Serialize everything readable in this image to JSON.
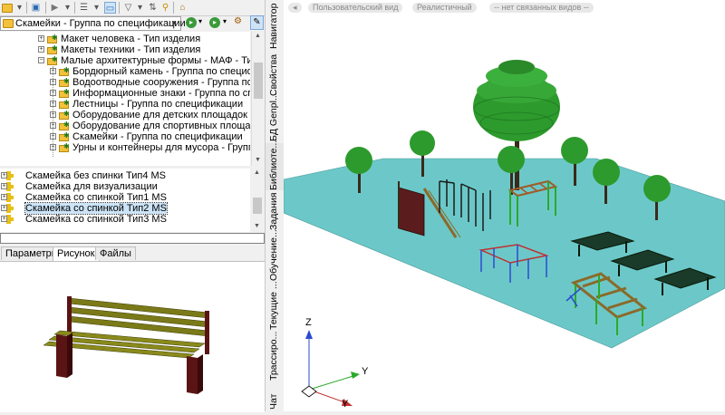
{
  "toolbar": {
    "icons": [
      "folder-icon",
      "dropdown-arrow",
      "save-icon",
      "play-icon",
      "dropdown-arrow",
      "tree-view-icon",
      "dropdown-arrow",
      "panel-icon",
      "filter-icon",
      "dropdown-arrow",
      "sort-icon",
      "search-icon",
      "pin-icon"
    ]
  },
  "combo": {
    "value": "Скамейки - Группа по спецификации"
  },
  "tree": {
    "items": [
      {
        "label": "Макет человека - Тип изделия",
        "level": 0,
        "expander": "+"
      },
      {
        "label": "Макеты техники - Тип изделия",
        "level": 0,
        "expander": "+"
      },
      {
        "label": "Малые архитектурные формы - МАФ - Тип изделия",
        "level": 0,
        "expander": "−"
      },
      {
        "label": "Бордюрный камень - Группа по спецификации",
        "level": 1,
        "expander": "+"
      },
      {
        "label": "Водоотводные сооружения - Группа по спецификации",
        "level": 1,
        "expander": "+"
      },
      {
        "label": "Информационные знаки - Группа по спецификации",
        "level": 1,
        "expander": "+"
      },
      {
        "label": "Лестницы - Группа по спецификации",
        "level": 1,
        "expander": "+"
      },
      {
        "label": "Оборудование для детских площадок - Группа по спецификации",
        "level": 1,
        "expander": "+"
      },
      {
        "label": "Оборудование для спортивных площадок - Группа по спецификации",
        "level": 1,
        "expander": "+"
      },
      {
        "label": "Скамейки - Группа по спецификации",
        "level": 1,
        "expander": "+"
      },
      {
        "label": "Урны и контейнеры для мусора - Группа по спецификации",
        "level": 1,
        "expander": "+"
      }
    ]
  },
  "list": {
    "items": [
      {
        "label": "Скамейка без спинки Тип4 MS",
        "selected": false
      },
      {
        "label": "Скамейка для визуализации",
        "selected": false
      },
      {
        "label": "Скамейка со спинкой Тип1 MS",
        "selected": false
      },
      {
        "label": "Скамейка со спинкой Тип2 MS",
        "selected": true
      },
      {
        "label": "Скамейка со спинкой Тип3 MS",
        "selected": false
      }
    ]
  },
  "filter": {
    "value": ""
  },
  "tabs": [
    {
      "label": "Параметры",
      "active": false
    },
    {
      "label": "Рисунок",
      "active": true
    },
    {
      "label": "Файлы",
      "active": false
    }
  ],
  "side_tabs": [
    {
      "label": "Навигатор",
      "active": false
    },
    {
      "label": "Свойства",
      "active": false
    },
    {
      "label": "БД Genpl...",
      "active": false
    },
    {
      "label": "Библиоте...",
      "active": true
    },
    {
      "label": "Задания",
      "active": false
    },
    {
      "label": "Обучение...",
      "active": false
    },
    {
      "label": "Текущие ...",
      "active": false
    },
    {
      "label": "Трассиро...",
      "active": false
    },
    {
      "label": "Чат",
      "active": false
    }
  ],
  "viewport": {
    "pills": [
      "◂",
      "Пользовательский вид",
      "Реалистичный",
      "-- нет связанных видов --"
    ],
    "axes": {
      "z": "Z",
      "y1": "Y",
      "y2": "Y"
    },
    "colors": {
      "ground": "#6cc8c8",
      "tree": "#2d9a2d",
      "trunk": "#3a2a1a"
    }
  },
  "colors": {
    "selection": "#cce4f7",
    "bench_wood": "#7a7a18",
    "bench_leg": "#5a1414"
  }
}
